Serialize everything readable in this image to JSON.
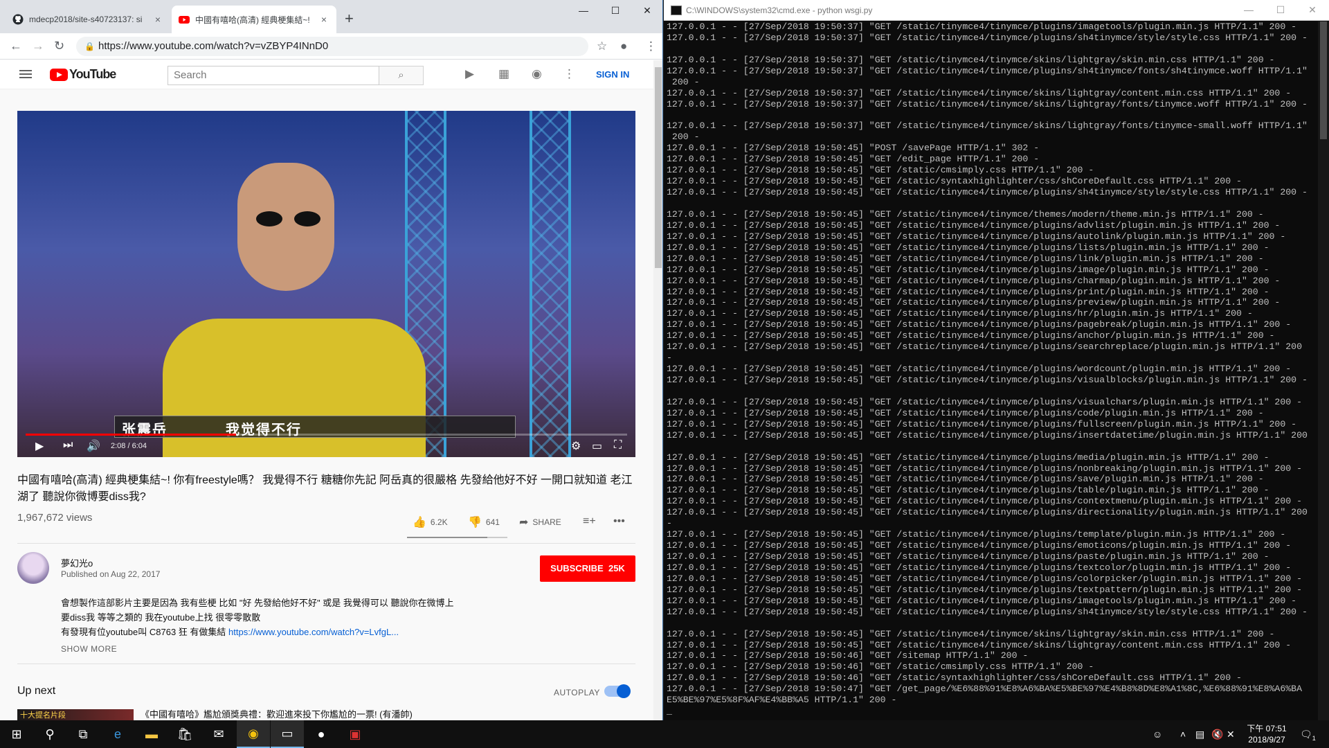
{
  "chrome": {
    "tabs": [
      {
        "title": "mdecp2018/site-s40723137: si",
        "active": false,
        "icon": "github-icon"
      },
      {
        "title": "中國有嘻哈(高清) 經典梗集結~! ",
        "active": true,
        "icon": "youtube-icon"
      }
    ],
    "url": "https://www.youtube.com/watch?v=vZBYP4INnD0"
  },
  "youtube": {
    "logo_text": "YouTube",
    "search_placeholder": "Search",
    "signin": "SIGN IN",
    "player": {
      "subtitle_name": "张震岳",
      "subtitle_text": "我觉得不行",
      "time": "2:08 / 6:04",
      "progress": 0.35
    },
    "video_title": "中國有嘻哈(高清) 經典梗集結~! 你有freestyle嗎？ 我覺得不行 糖糖你先記 阿岳真的很嚴格 先發給他好不好 一開口就知道 老江湖了 聽說你微博要diss我?",
    "views": "1,967,672 views",
    "likes": "6.2K",
    "dislikes": "641",
    "share": "SHARE",
    "like_ratio": 0.8,
    "channel": "夢幻光o",
    "published": "Published on Aug 22, 2017",
    "subscribe": "SUBSCRIBE",
    "subscribers": "25K",
    "description": [
      "會想製作這部影片主要是因為 我有些梗 比如 \"好 先發給他好不好\" 或是 我覺得可以 聽說你在微博上",
      "要diss我 等等之類的  我在youtube上找 很零零散散",
      "有發現有位youtube叫 C8763 狂 有做集結 "
    ],
    "description_link": "https://www.youtube.com/watch?v=LvfgL...",
    "show_more": "SHOW MORE",
    "up_next": "Up next",
    "autoplay": "AUTOPLAY",
    "next_thumb_text": "十大提名片段",
    "next_title": "《中國有嘻哈》尷尬頒獎典禮：歡迎進來投下你尷尬的一票! (有潘帥)"
  },
  "cmd": {
    "title": "C:\\WINDOWS\\system32\\cmd.exe - python  wsgi.py",
    "lines": [
      "127.0.0.1 - - [27/Sep/2018 19:50:37] \"GET /static/tinymce4/tinymce/plugins/imagetools/plugin.min.js HTTP/1.1\" 200 -",
      "127.0.0.1 - - [27/Sep/2018 19:50:37] \"GET /static/tinymce4/tinymce/plugins/sh4tinymce/style/style.css HTTP/1.1\" 200 -",
      "",
      "127.0.0.1 - - [27/Sep/2018 19:50:37] \"GET /static/tinymce4/tinymce/skins/lightgray/skin.min.css HTTP/1.1\" 200 -",
      "127.0.0.1 - - [27/Sep/2018 19:50:37] \"GET /static/tinymce4/tinymce/plugins/sh4tinymce/fonts/sh4tinymce.woff HTTP/1.1\"",
      " 200 -",
      "127.0.0.1 - - [27/Sep/2018 19:50:37] \"GET /static/tinymce4/tinymce/skins/lightgray/content.min.css HTTP/1.1\" 200 -",
      "127.0.0.1 - - [27/Sep/2018 19:50:37] \"GET /static/tinymce4/tinymce/skins/lightgray/fonts/tinymce.woff HTTP/1.1\" 200 -",
      "",
      "127.0.0.1 - - [27/Sep/2018 19:50:37] \"GET /static/tinymce4/tinymce/skins/lightgray/fonts/tinymce-small.woff HTTP/1.1\"",
      " 200 -",
      "127.0.0.1 - - [27/Sep/2018 19:50:45] \"POST /savePage HTTP/1.1\" 302 -",
      "127.0.0.1 - - [27/Sep/2018 19:50:45] \"GET /edit_page HTTP/1.1\" 200 -",
      "127.0.0.1 - - [27/Sep/2018 19:50:45] \"GET /static/cmsimply.css HTTP/1.1\" 200 -",
      "127.0.0.1 - - [27/Sep/2018 19:50:45] \"GET /static/syntaxhighlighter/css/shCoreDefault.css HTTP/1.1\" 200 -",
      "127.0.0.1 - - [27/Sep/2018 19:50:45] \"GET /static/tinymce4/tinymce/plugins/sh4tinymce/style/style.css HTTP/1.1\" 200 -",
      "",
      "127.0.0.1 - - [27/Sep/2018 19:50:45] \"GET /static/tinymce4/tinymce/themes/modern/theme.min.js HTTP/1.1\" 200 -",
      "127.0.0.1 - - [27/Sep/2018 19:50:45] \"GET /static/tinymce4/tinymce/plugins/advlist/plugin.min.js HTTP/1.1\" 200 -",
      "127.0.0.1 - - [27/Sep/2018 19:50:45] \"GET /static/tinymce4/tinymce/plugins/autolink/plugin.min.js HTTP/1.1\" 200 -",
      "127.0.0.1 - - [27/Sep/2018 19:50:45] \"GET /static/tinymce4/tinymce/plugins/lists/plugin.min.js HTTP/1.1\" 200 -",
      "127.0.0.1 - - [27/Sep/2018 19:50:45] \"GET /static/tinymce4/tinymce/plugins/link/plugin.min.js HTTP/1.1\" 200 -",
      "127.0.0.1 - - [27/Sep/2018 19:50:45] \"GET /static/tinymce4/tinymce/plugins/image/plugin.min.js HTTP/1.1\" 200 -",
      "127.0.0.1 - - [27/Sep/2018 19:50:45] \"GET /static/tinymce4/tinymce/plugins/charmap/plugin.min.js HTTP/1.1\" 200 -",
      "127.0.0.1 - - [27/Sep/2018 19:50:45] \"GET /static/tinymce4/tinymce/plugins/print/plugin.min.js HTTP/1.1\" 200 -",
      "127.0.0.1 - - [27/Sep/2018 19:50:45] \"GET /static/tinymce4/tinymce/plugins/preview/plugin.min.js HTTP/1.1\" 200 -",
      "127.0.0.1 - - [27/Sep/2018 19:50:45] \"GET /static/tinymce4/tinymce/plugins/hr/plugin.min.js HTTP/1.1\" 200 -",
      "127.0.0.1 - - [27/Sep/2018 19:50:45] \"GET /static/tinymce4/tinymce/plugins/pagebreak/plugin.min.js HTTP/1.1\" 200 -",
      "127.0.0.1 - - [27/Sep/2018 19:50:45] \"GET /static/tinymce4/tinymce/plugins/anchor/plugin.min.js HTTP/1.1\" 200 -",
      "127.0.0.1 - - [27/Sep/2018 19:50:45] \"GET /static/tinymce4/tinymce/plugins/searchreplace/plugin.min.js HTTP/1.1\" 200",
      "-",
      "127.0.0.1 - - [27/Sep/2018 19:50:45] \"GET /static/tinymce4/tinymce/plugins/wordcount/plugin.min.js HTTP/1.1\" 200 -",
      "127.0.0.1 - - [27/Sep/2018 19:50:45] \"GET /static/tinymce4/tinymce/plugins/visualblocks/plugin.min.js HTTP/1.1\" 200 -",
      "",
      "127.0.0.1 - - [27/Sep/2018 19:50:45] \"GET /static/tinymce4/tinymce/plugins/visualchars/plugin.min.js HTTP/1.1\" 200 -",
      "127.0.0.1 - - [27/Sep/2018 19:50:45] \"GET /static/tinymce4/tinymce/plugins/code/plugin.min.js HTTP/1.1\" 200 -",
      "127.0.0.1 - - [27/Sep/2018 19:50:45] \"GET /static/tinymce4/tinymce/plugins/fullscreen/plugin.min.js HTTP/1.1\" 200 -",
      "127.0.0.1 - - [27/Sep/2018 19:50:45] \"GET /static/tinymce4/tinymce/plugins/insertdatetime/plugin.min.js HTTP/1.1\" 200",
      "",
      "127.0.0.1 - - [27/Sep/2018 19:50:45] \"GET /static/tinymce4/tinymce/plugins/media/plugin.min.js HTTP/1.1\" 200 -",
      "127.0.0.1 - - [27/Sep/2018 19:50:45] \"GET /static/tinymce4/tinymce/plugins/nonbreaking/plugin.min.js HTTP/1.1\" 200 -",
      "127.0.0.1 - - [27/Sep/2018 19:50:45] \"GET /static/tinymce4/tinymce/plugins/save/plugin.min.js HTTP/1.1\" 200 -",
      "127.0.0.1 - - [27/Sep/2018 19:50:45] \"GET /static/tinymce4/tinymce/plugins/table/plugin.min.js HTTP/1.1\" 200 -",
      "127.0.0.1 - - [27/Sep/2018 19:50:45] \"GET /static/tinymce4/tinymce/plugins/contextmenu/plugin.min.js HTTP/1.1\" 200 -",
      "127.0.0.1 - - [27/Sep/2018 19:50:45] \"GET /static/tinymce4/tinymce/plugins/directionality/plugin.min.js HTTP/1.1\" 200",
      "-",
      "127.0.0.1 - - [27/Sep/2018 19:50:45] \"GET /static/tinymce4/tinymce/plugins/template/plugin.min.js HTTP/1.1\" 200 -",
      "127.0.0.1 - - [27/Sep/2018 19:50:45] \"GET /static/tinymce4/tinymce/plugins/emoticons/plugin.min.js HTTP/1.1\" 200 -",
      "127.0.0.1 - - [27/Sep/2018 19:50:45] \"GET /static/tinymce4/tinymce/plugins/paste/plugin.min.js HTTP/1.1\" 200 -",
      "127.0.0.1 - - [27/Sep/2018 19:50:45] \"GET /static/tinymce4/tinymce/plugins/textcolor/plugin.min.js HTTP/1.1\" 200 -",
      "127.0.0.1 - - [27/Sep/2018 19:50:45] \"GET /static/tinymce4/tinymce/plugins/colorpicker/plugin.min.js HTTP/1.1\" 200 -",
      "127.0.0.1 - - [27/Sep/2018 19:50:45] \"GET /static/tinymce4/tinymce/plugins/textpattern/plugin.min.js HTTP/1.1\" 200 -",
      "127.0.0.1 - - [27/Sep/2018 19:50:45] \"GET /static/tinymce4/tinymce/plugins/imagetools/plugin.min.js HTTP/1.1\" 200 -",
      "127.0.0.1 - - [27/Sep/2018 19:50:45] \"GET /static/tinymce4/tinymce/plugins/sh4tinymce/style/style.css HTTP/1.1\" 200 -",
      "",
      "127.0.0.1 - - [27/Sep/2018 19:50:45] \"GET /static/tinymce4/tinymce/skins/lightgray/skin.min.css HTTP/1.1\" 200 -",
      "127.0.0.1 - - [27/Sep/2018 19:50:45] \"GET /static/tinymce4/tinymce/skins/lightgray/content.min.css HTTP/1.1\" 200 -",
      "127.0.0.1 - - [27/Sep/2018 19:50:46] \"GET /sitemap HTTP/1.1\" 200 -",
      "127.0.0.1 - - [27/Sep/2018 19:50:46] \"GET /static/cmsimply.css HTTP/1.1\" 200 -",
      "127.0.0.1 - - [27/Sep/2018 19:50:46] \"GET /static/syntaxhighlighter/css/shCoreDefault.css HTTP/1.1\" 200 -",
      "127.0.0.1 - - [27/Sep/2018 19:50:47] \"GET /get_page/%E6%88%91%E8%A6%BA%E5%BE%97%E4%B8%8D%E8%A1%8C,%E6%88%91%E8%A6%BA",
      "E5%BE%97%E5%8F%AF%E4%BB%A5 HTTP/1.1\" 200 -",
      "_"
    ]
  },
  "taskbar": {
    "time": "下午 07:51",
    "date": "2018/9/27",
    "notification_count": "1"
  },
  "colors": {
    "youtube_red": "#ff0000",
    "link_blue": "#065fd4",
    "cmd_text": "#c0c0c0",
    "cmd_bg": "#0c0c0c"
  }
}
